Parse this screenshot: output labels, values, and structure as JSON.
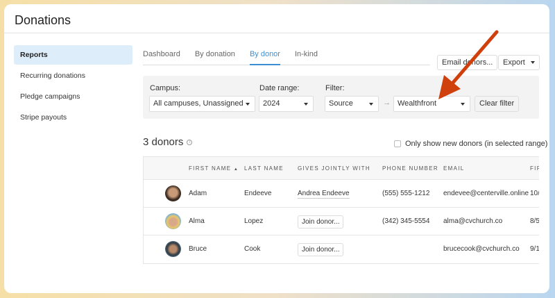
{
  "header": {
    "title": "Donations"
  },
  "sidebar": {
    "items": [
      {
        "label": "Reports",
        "active": true
      },
      {
        "label": "Recurring donations"
      },
      {
        "label": "Pledge campaigns"
      },
      {
        "label": "Stripe payouts"
      }
    ]
  },
  "tabs": [
    {
      "label": "Dashboard"
    },
    {
      "label": "By donation"
    },
    {
      "label": "By donor",
      "active": true
    },
    {
      "label": "In-kind"
    }
  ],
  "actions": {
    "email": "Email donors...",
    "export": "Export"
  },
  "filters": {
    "campus_label": "Campus:",
    "campus_value": "All campuses, Unassigned",
    "date_label": "Date range:",
    "date_value": "2024",
    "filter_label": "Filter:",
    "filter_value": "Source",
    "source_value": "Wealthfront",
    "clear": "Clear filter"
  },
  "summary": {
    "count": "3 donors",
    "new_only": "Only show new donors (in selected range)"
  },
  "table": {
    "headers": [
      "FIRST NAME",
      "LAST NAME",
      "GIVES JOINTLY WITH",
      "PHONE NUMBER",
      "EMAIL",
      "FIR"
    ],
    "rows": [
      {
        "first": "Adam",
        "last": "Endeeve",
        "joint": "Andrea Endeeve",
        "phone": "(555) 555-1212",
        "email": "endevee@centerville.online",
        "date": "10/"
      },
      {
        "first": "Alma",
        "last": "Lopez",
        "joint": "Join donor...",
        "phone": "(342) 345-5554",
        "email": "alma@cvchurch.co",
        "date": "8/5"
      },
      {
        "first": "Bruce",
        "last": "Cook",
        "joint": "Join donor...",
        "phone": "",
        "email": "brucecook@cvchurch.co",
        "date": "9/1"
      }
    ]
  },
  "colors": {
    "accent": "#3a8fd4",
    "arrow": "#d0400c"
  }
}
